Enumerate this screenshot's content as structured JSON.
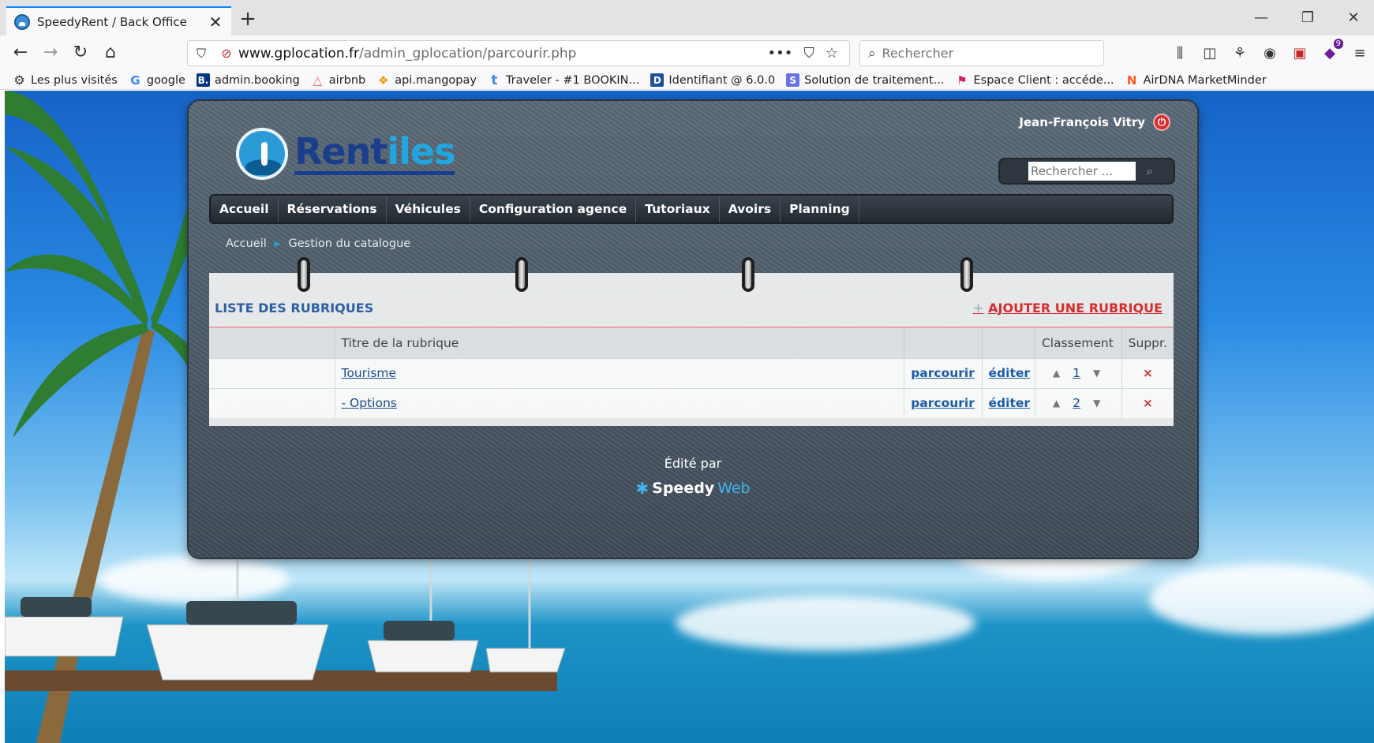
{
  "browser": {
    "tab_title": "SpeedyRent / Back Office",
    "url_host": "www.gplocation.fr",
    "url_path": "/admin_gplocation/parcourir.php",
    "search_placeholder": "Rechercher",
    "menu_badge": "9",
    "bookmarks": [
      {
        "label": "Les plus visités",
        "icon": "gear-icon",
        "color": "#333333"
      },
      {
        "label": "google",
        "icon": "G",
        "color": "#4285f4"
      },
      {
        "label": "admin.booking",
        "icon": "B.",
        "color": "#003580"
      },
      {
        "label": "airbnb",
        "icon": "airbnb-icon",
        "color": "#ff5a5f"
      },
      {
        "label": "api.mangopay",
        "icon": "mangopay-icon",
        "color": "#f39200"
      },
      {
        "label": "Traveler - #1 BOOKIN...",
        "icon": "t",
        "color": "#3b8ee6"
      },
      {
        "label": "Identifiant @ 6.0.0",
        "icon": "D",
        "color": "#1e4f99"
      },
      {
        "label": "Solution de traitement...",
        "icon": "S",
        "color": "#6772e5"
      },
      {
        "label": "Espace Client : accéde...",
        "icon": "flag-icon",
        "color": "#d81b60"
      },
      {
        "label": "AirDNA MarketMinder",
        "icon": "N",
        "color": "#ff5722"
      }
    ]
  },
  "page": {
    "user_name": "Jean-François Vitry",
    "logo_part1": "Rent",
    "logo_part2": "iles",
    "search_placeholder": "Rechercher ...",
    "menu": [
      "Accueil",
      "Réservations",
      "Véhicules",
      "Configuration agence",
      "Tutoriaux",
      "Avoirs",
      "Planning"
    ],
    "breadcrumb": [
      "Accueil",
      "Gestion du catalogue"
    ],
    "list_title": "LISTE DES RUBRIQUES",
    "add_label": "AJOUTER UNE RUBRIQUE",
    "columns": {
      "title": "Titre de la rubrique",
      "rank": "Classement",
      "delete": "Suppr."
    },
    "rows": [
      {
        "title": "Tourisme",
        "browse": "parcourir",
        "edit": "éditer",
        "rank": "1",
        "delete": "×"
      },
      {
        "title": "- Options",
        "browse": "parcourir",
        "edit": "éditer",
        "rank": "2",
        "delete": "×"
      }
    ],
    "footer_text": "Édité par",
    "footer_brand_a": "Speedy",
    "footer_brand_b": "Web",
    "accent_color": "#d32f2f",
    "brand_color": "#1b3e8c"
  }
}
